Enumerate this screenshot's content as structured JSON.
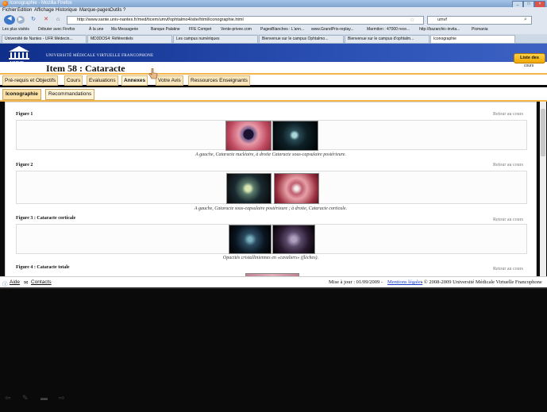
{
  "window": {
    "title": "Iconographie - Mozilla Firefox"
  },
  "menu": [
    "Fichier",
    "Edition",
    "Affichage",
    "Historique",
    "Marque-pages",
    "Outils",
    "?"
  ],
  "address": {
    "url": "http://www.sante.univ-nantes.fr/med/ticem/umvf/ophtalmo4/site/html/iconographie.html"
  },
  "search": {
    "value": "umvf"
  },
  "bookmarks": [
    "Les plus visités",
    "Débuter avec Firefox",
    "À la une",
    "Ma Messagerie",
    "Banque Palatine",
    "FFE Compet",
    "Vente-privee.com",
    "PagesBlanches : L'ann...",
    "www.GrandPrix-replay...",
    "Marmiton : 47000 rece...",
    "http://bazarchic-invita...",
    "Pixmania"
  ],
  "tabs": [
    "Université de Nantes - UFR Médecin...",
    "MD3DOS4: Référentiels",
    "Les campus numériques",
    "Bienvenue sur le campus Ophtalmo...",
    "Bienvenue sur le campus d'ophtalm...",
    "Iconographie"
  ],
  "header": {
    "university": "UNIVERSITÉ MÉDICALE VIRTUELLE FRANCOPHONE",
    "logo": "UMVF",
    "item_title": "Item 58 : Cataracte",
    "liste_button": "Liste des",
    "liste_sub": "cours"
  },
  "nav_tabs": [
    "Pré-requis et Objectifs",
    "Cours",
    "Evaluations",
    "Annexes",
    "Votre Avis",
    "Ressources Enseignants"
  ],
  "sub_tabs": [
    "Iconographie",
    "Recommandations"
  ],
  "figures": [
    {
      "title": "Figure 1",
      "retour": "Retour au cours",
      "caption": "A gauche, Cataracte nucléaire, à droite Cataracte sous-capsulaire postérieure."
    },
    {
      "title": "Figure 2",
      "retour": "Retour au cours",
      "caption": "A gauche, Cataracte sous-capsulaire postérieure ; à droite, Cataracte corticale."
    },
    {
      "title": "Figure 3 : Cataracte corticale",
      "retour": "Retour au cours",
      "caption": "Opacités cristalliniennes en «cavaliers» (flèches)."
    },
    {
      "title": "Figure 4 : Cataracte totale",
      "retour": "Retour au cours",
      "caption": ""
    }
  ],
  "footer": {
    "aide": "Aide",
    "contacts": "Contacts",
    "update": "Mise à jour : 01/09/2009 -",
    "mentions": "Mentions légales",
    "copyright": "- © 2008-2009 Université Médicale Virtuelle Francophone"
  },
  "colors": {
    "banner": "#1a3a9a",
    "tab_accent": "#f3b54a",
    "liste_btn": "#f5b800"
  }
}
